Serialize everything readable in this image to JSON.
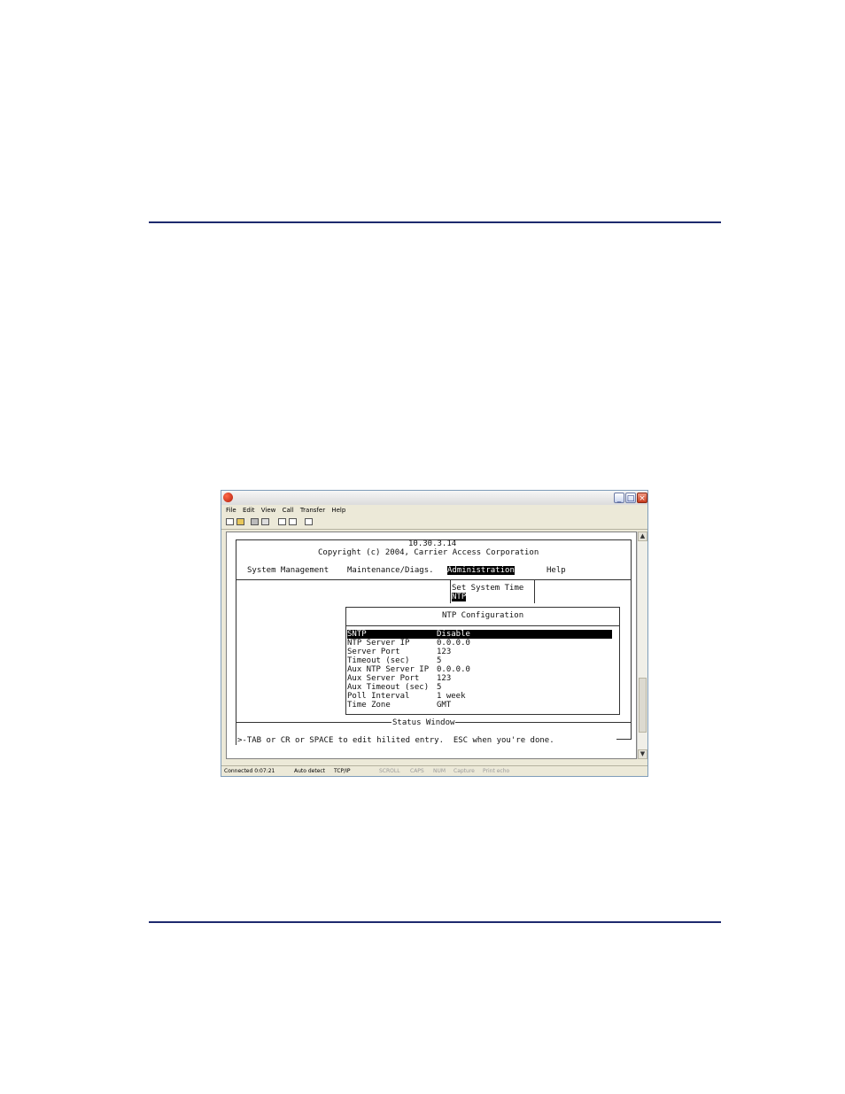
{
  "window": {
    "menu": [
      "File",
      "Edit",
      "View",
      "Call",
      "Transfer",
      "Help"
    ],
    "controls": {
      "minimize": "_",
      "maximize": "□",
      "close": "×"
    }
  },
  "terminal": {
    "ip": "10.30.3.14",
    "copyright": "Copyright (c) 2004, Carrier Access Corporation",
    "menu": {
      "system_management": "System Management",
      "maintenance": "Maintenance/Diags.",
      "administration": "Administration",
      "help": "Help"
    },
    "submenu": {
      "set_system_time": "Set System Time",
      "ntp": "NTP"
    },
    "dialog": {
      "title": "NTP Configuration",
      "rows": [
        {
          "label": "SNTP",
          "value": "Disable"
        },
        {
          "label": "NTP Server IP",
          "value": "0.0.0.0"
        },
        {
          "label": "Server Port",
          "value": "123"
        },
        {
          "label": "Timeout (sec)",
          "value": "5"
        },
        {
          "label": "Aux NTP Server IP",
          "value": "0.0.0.0"
        },
        {
          "label": "Aux Server Port",
          "value": "123"
        },
        {
          "label": "Aux Timeout (sec)",
          "value": "5"
        },
        {
          "label": "Poll Interval",
          "value": "1 week"
        },
        {
          "label": "Time Zone",
          "value": "GMT"
        }
      ]
    },
    "status_window_label": "Status Window",
    "status_message": ">-TAB or CR or SPACE to edit hilited entry.  ESC when you're done."
  },
  "statusbar": {
    "connected": "Connected 0:07:21",
    "detect": "Auto detect",
    "protocol": "TCP/IP",
    "scroll": "SCROLL",
    "caps": "CAPS",
    "num": "NUM",
    "capture": "Capture",
    "print": "Print echo"
  },
  "colors": {
    "rule": "#1e2a6e",
    "highlight_bg": "#000000",
    "highlight_fg": "#ffffff"
  }
}
